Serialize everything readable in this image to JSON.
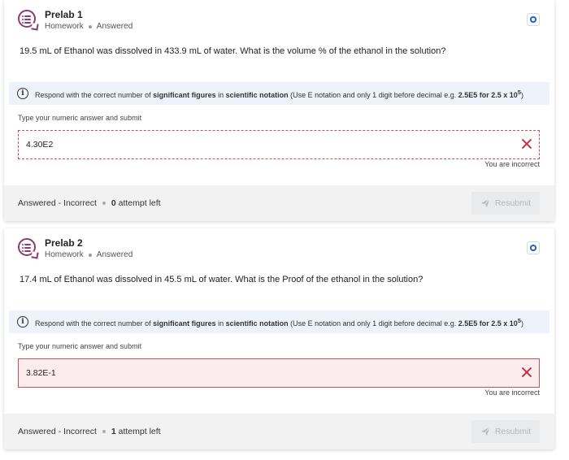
{
  "cards": [
    {
      "title": "Prelab 1",
      "type": "Homework",
      "status": "Answered",
      "question": "19.5 mL of Ethanol was dissolved in 433.9 mL of water. What is the volume % of the ethanol in the solution?",
      "hint": {
        "p1": "Respond with the correct number of ",
        "b1": "significant figures",
        "p2": " in ",
        "b2": "scientific notation",
        "p3": " (Use E notation and only 1 digit before decimal e.g. ",
        "b3": "2.5E5 for 2.5 x 10",
        "sup": "5",
        "p4": ")"
      },
      "field_label": "Type your numeric answer and submit",
      "answer": "4.30E2",
      "feedback": "You are incorrect",
      "footer_status": "Answered - Incorrect",
      "attempts_count": "0",
      "attempts_suffix": " attempt left",
      "resubmit_label": "Resubmit"
    },
    {
      "title": "Prelab 2",
      "type": "Homework",
      "status": "Answered",
      "question": "17.4 mL of Ethanol was dissolved in 45.5 mL of water. What is the Proof of the ethanol in the solution?",
      "hint": {
        "p1": "Respond with the correct number of ",
        "b1": "significant figures",
        "p2": " in ",
        "b2": "scientific notation",
        "p3": " (Use E notation and only 1 digit before decimal e.g. ",
        "b3": "2.5E5 for 2.5 x 10",
        "sup": "5",
        "p4": ")"
      },
      "field_label": "Type your numeric answer and submit",
      "answer": "3.82E-1",
      "feedback": "You are incorrect",
      "footer_status": "Answered - Incorrect",
      "attempts_count": "1",
      "attempts_suffix": " attempt left",
      "resubmit_label": "Resubmit"
    }
  ],
  "icons": {
    "question": "question-list-icon",
    "bookmark": "bookmark-icon",
    "info": "info-icon",
    "incorrect": "close-x-icon",
    "resubmit": "send-icon"
  },
  "colors": {
    "accent": "#8c3b78",
    "error": "#c62f3e",
    "hint_bg": "#eef3fb",
    "link_blue": "#2b66c9"
  }
}
